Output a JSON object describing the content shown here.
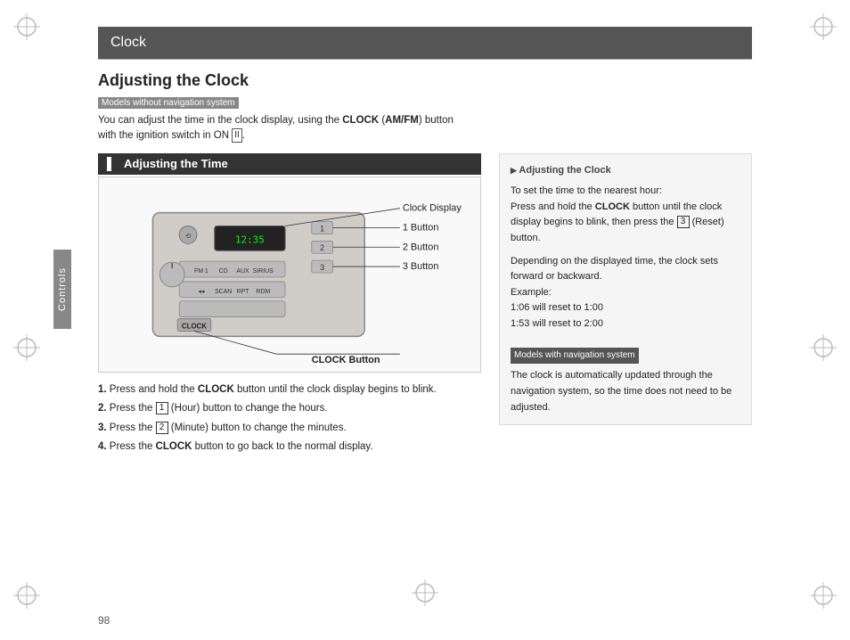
{
  "header": {
    "title": "Clock"
  },
  "page": {
    "title": "Adjusting the Clock",
    "page_number": "98",
    "sidebar_label": "Controls"
  },
  "models_badge": {
    "without_nav": "Models without navigation system",
    "with_nav": "Models with navigation system"
  },
  "intro": {
    "text_before_bold": "You can adjust the time in the clock display, using the ",
    "bold1": "CLOCK",
    "text_middle1": " (",
    "bold2": "AM/FM",
    "text_middle2": ") button with the ignition switch in ON ",
    "ignition_symbol": "II",
    "text_end": "."
  },
  "section": {
    "adjusting_time_label": "Adjusting the Time"
  },
  "diagram": {
    "label_button1": "1 Button",
    "label_button2": "2 Button",
    "label_button3": "3 Button",
    "label_clock_display": "Clock Display",
    "label_clock_button": "CLOCK Button"
  },
  "steps": [
    {
      "num": "1",
      "text_before": "Press and hold the ",
      "bold": "CLOCK",
      "text_after": " button until the clock display begins to blink."
    },
    {
      "num": "2",
      "text_before": "Press the ",
      "box": "1",
      "text_middle": " (Hour) button to change the hours.",
      "bold": ""
    },
    {
      "num": "3",
      "text_before": "Press the ",
      "box": "2",
      "text_middle": " (Minute) button to change the minutes.",
      "bold": ""
    },
    {
      "num": "4",
      "text_before": "Press the ",
      "bold": "CLOCK",
      "text_after": " button to go back to the normal display."
    }
  ],
  "right_col": {
    "heading": "Adjusting the Clock",
    "paragraphs": [
      "To set the time to the nearest hour:",
      "Press and hold the CLOCK button until the clock display begins to blink, then press the 3 (Reset) button.",
      "",
      "Depending on the displayed time, the clock sets forward or backward.",
      "Example:",
      "1:06 will reset to 1:00",
      "1:53 will reset to 2:00"
    ],
    "nav_text": "The clock is automatically updated through the navigation system, so the time does not need to be adjusted."
  }
}
